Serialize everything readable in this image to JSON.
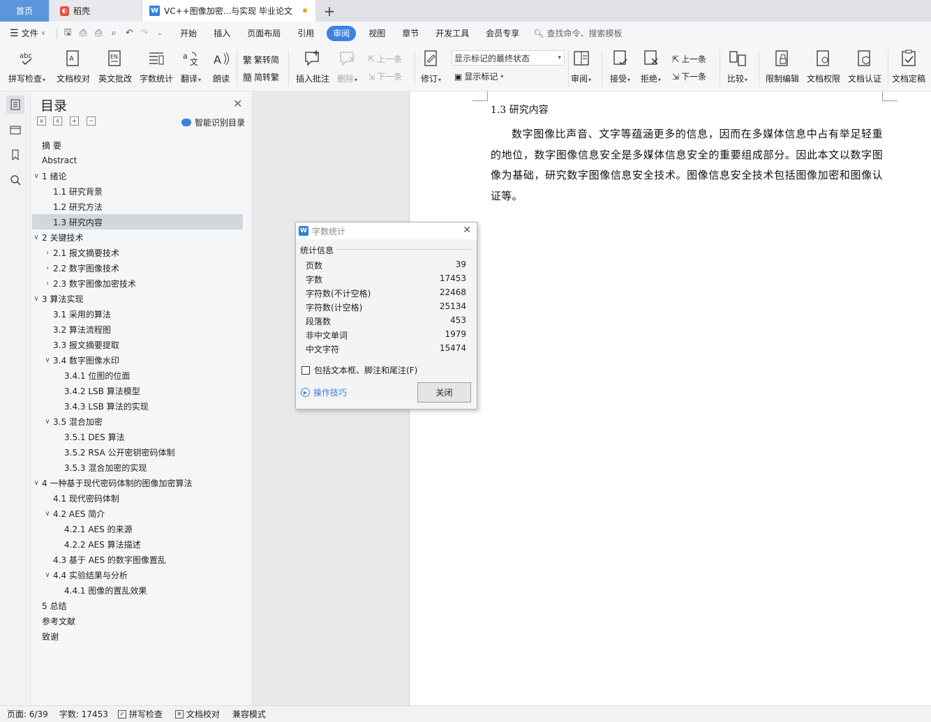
{
  "tabs": {
    "home": "首页",
    "daoke": "稻壳",
    "doc": "VC++图像加密...与实现 毕业论文",
    "add": "+"
  },
  "menu": {
    "file": "文件",
    "items": [
      "开始",
      "插入",
      "页面布局",
      "引用",
      "审阅",
      "视图",
      "章节",
      "开发工具",
      "会员专享"
    ],
    "active": "审阅",
    "search": "查找命令、搜索模板"
  },
  "ribbon": {
    "spell": "拼写检查",
    "proof": "文档校对",
    "en_correct": "英文批改",
    "word_count": "字数统计",
    "translate": "翻译",
    "read": "朗读",
    "trad": "繁转简",
    "simp": "简转繁",
    "insert_comment": "插入批注",
    "delete": "删除",
    "prev_comment": "上一条",
    "next_comment": "下一条",
    "revise": "修订",
    "markup_state": "显示标记的最终状态",
    "show_markup": "显示标记",
    "review": "审阅",
    "accept": "接受",
    "reject": "拒绝",
    "prev": "上一条",
    "next": "下一条",
    "compare": "比较",
    "restrict": "限制编辑",
    "rights": "文档权限",
    "certify": "文档认证",
    "finalize": "文档定稿"
  },
  "toc": {
    "title": "目录",
    "smart": "智能识别目录",
    "items": [
      {
        "label": "摘  要",
        "level": 0,
        "arrow": ""
      },
      {
        "label": "Abstract",
        "level": 0,
        "arrow": ""
      },
      {
        "label": "1  绪论",
        "level": 0,
        "arrow": "v"
      },
      {
        "label": "1.1  研究背景",
        "level": 1,
        "arrow": ""
      },
      {
        "label": "1.2  研究方法",
        "level": 1,
        "arrow": ""
      },
      {
        "label": "1.3  研究内容",
        "level": 1,
        "arrow": "",
        "selected": true
      },
      {
        "label": "2  关键技术",
        "level": 0,
        "arrow": "v"
      },
      {
        "label": "2.1  报文摘要技术",
        "level": 1,
        "arrow": ">"
      },
      {
        "label": "2.2  数字图像技术",
        "level": 1,
        "arrow": ">"
      },
      {
        "label": "2.3  数字图像加密技术",
        "level": 1,
        "arrow": ">"
      },
      {
        "label": "3  算法实现",
        "level": 0,
        "arrow": "v"
      },
      {
        "label": "3.1  采用的算法",
        "level": 1,
        "arrow": ""
      },
      {
        "label": "3.2  算法流程图",
        "level": 1,
        "arrow": ""
      },
      {
        "label": "3.3  报文摘要提取",
        "level": 1,
        "arrow": ""
      },
      {
        "label": "3.4  数字图像水印",
        "level": 1,
        "arrow": "v"
      },
      {
        "label": "3.4.1  位图的位面",
        "level": 2,
        "arrow": ""
      },
      {
        "label": "3.4.2 LSB 算法模型",
        "level": 2,
        "arrow": ""
      },
      {
        "label": "3.4.3 LSB 算法的实现",
        "level": 2,
        "arrow": ""
      },
      {
        "label": "3.5  混合加密",
        "level": 1,
        "arrow": "v"
      },
      {
        "label": "3.5.1 DES 算法",
        "level": 2,
        "arrow": ""
      },
      {
        "label": "3.5.2 RSA 公开密钥密码体制",
        "level": 2,
        "arrow": ""
      },
      {
        "label": "3.5.3  混合加密的实现",
        "level": 2,
        "arrow": ""
      },
      {
        "label": "4  一种基于现代密码体制的图像加密算法",
        "level": 0,
        "arrow": "v"
      },
      {
        "label": "4.1 现代密码体制",
        "level": 1,
        "arrow": ""
      },
      {
        "label": "4.2 AES 简介",
        "level": 1,
        "arrow": "v"
      },
      {
        "label": "4.2.1 AES 的来源",
        "level": 2,
        "arrow": ""
      },
      {
        "label": "4.2.2 AES 算法描述",
        "level": 2,
        "arrow": ""
      },
      {
        "label": "4.3  基于 AES 的数字图像置乱",
        "level": 1,
        "arrow": ""
      },
      {
        "label": "4.4  实验结果与分析",
        "level": 1,
        "arrow": "v"
      },
      {
        "label": "4.4.1  图像的置乱效果",
        "level": 2,
        "arrow": ""
      },
      {
        "label": "5  总结",
        "level": 0,
        "arrow": ""
      },
      {
        "label": "参考文献",
        "level": 0,
        "arrow": ""
      },
      {
        "label": "致谢",
        "level": 0,
        "arrow": ""
      }
    ]
  },
  "doc": {
    "heading": "1.3  研究内容",
    "body": "数字图像比声音、文字等蕴涵更多的信息，因而在多媒体信息中占有举足轻重的地位，数字图像信息安全是多媒体信息安全的重要组成部分。因此本文以数字图像为基础，研究数字图像信息安全技术。图像信息安全技术包括图像加密和图像认证等。"
  },
  "dialog": {
    "title": "字数统计",
    "section": "统计信息",
    "rows": [
      {
        "label": "页数",
        "value": "39"
      },
      {
        "label": "字数",
        "value": "17453"
      },
      {
        "label": "字符数(不计空格)",
        "value": "22468"
      },
      {
        "label": "字符数(计空格)",
        "value": "25134"
      },
      {
        "label": "段落数",
        "value": "453"
      },
      {
        "label": "非中文单词",
        "value": "1979"
      },
      {
        "label": "中文字符",
        "value": "15474"
      }
    ],
    "checkbox": "包括文本框、脚注和尾注(F)",
    "tips": "操作技巧",
    "close": "关闭"
  },
  "status": {
    "page": "页面: 6/39",
    "words": "字数: 17453",
    "spell": "拼写检查",
    "proof": "文档校对",
    "compat": "兼容模式"
  },
  "colors": {
    "accent": "#3c82e0",
    "home_tab": "#5b95dc",
    "selected_row": "#d3d7dd"
  }
}
